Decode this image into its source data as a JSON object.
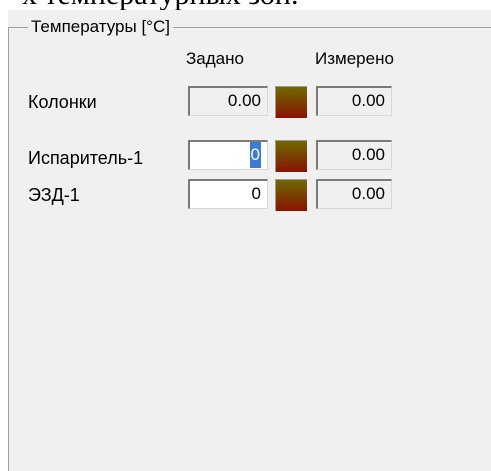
{
  "caption_fragment": "х температурных зон.",
  "group": {
    "title": "Температуры [°C]",
    "col_set": "Задано",
    "col_measured": "Измерено"
  },
  "rows": [
    {
      "label": "Колонки",
      "set_value": "0.00",
      "measured": "0.00",
      "set_editable": false
    },
    {
      "label": "Испаритель-1",
      "set_value": "0",
      "measured": "0.00",
      "set_editable": true
    },
    {
      "label": "ЭЗД-1",
      "set_value": "0",
      "measured": "0.00",
      "set_editable": true
    }
  ],
  "colors": {
    "panel_bg": "#f0f0f0",
    "indicator_top": "#6f6a00",
    "indicator_bottom": "#8c1200"
  }
}
